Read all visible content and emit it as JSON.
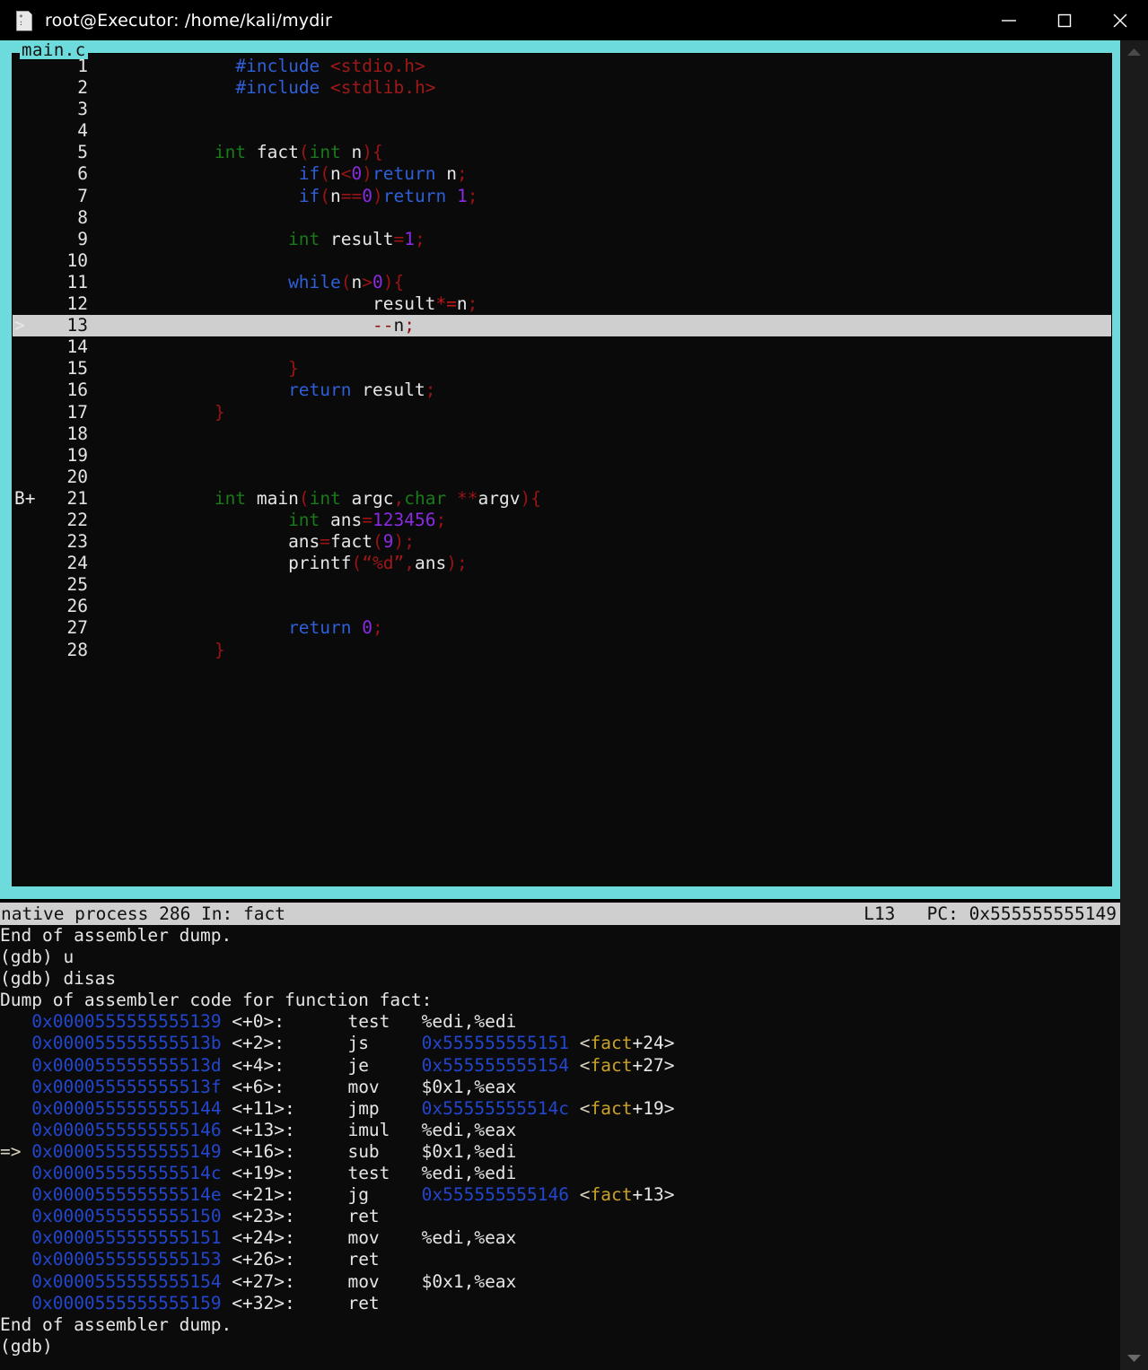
{
  "window": {
    "title": "root@Executor: /home/kali/mydir",
    "icon": "terminal-file-icon",
    "controls": {
      "minimize": "minimize-icon",
      "maximize": "maximize-icon",
      "close": "close-icon"
    }
  },
  "colors": {
    "frame": "#6ddbdb",
    "background": "#0b0b0b",
    "status_bg": "#cfcfcf",
    "address": "#2346cf",
    "symbol": "#c9a227",
    "keyword": "#2f5fd8",
    "type": "#1a7a1a",
    "punct": "#9b1414",
    "number": "#8a2be2",
    "string": "#a01818"
  },
  "source_pane": {
    "label": "main.c",
    "lines": [
      {
        "num": "1",
        "mark": "",
        "active": false,
        "tokens": [
          {
            "t": "              ",
            "c": "id"
          },
          {
            "t": "#include ",
            "c": "pre"
          },
          {
            "t": "<stdio.h>",
            "c": "str"
          }
        ]
      },
      {
        "num": "2",
        "mark": "",
        "active": false,
        "tokens": [
          {
            "t": "              ",
            "c": "id"
          },
          {
            "t": "#include ",
            "c": "pre"
          },
          {
            "t": "<stdlib.h>",
            "c": "str"
          }
        ]
      },
      {
        "num": "3",
        "mark": "",
        "active": false,
        "tokens": []
      },
      {
        "num": "4",
        "mark": "",
        "active": false,
        "tokens": []
      },
      {
        "num": "5",
        "mark": "",
        "active": false,
        "tokens": [
          {
            "t": "            ",
            "c": "id"
          },
          {
            "t": "int",
            "c": "type"
          },
          {
            "t": " fact",
            "c": "id"
          },
          {
            "t": "(",
            "c": "punc"
          },
          {
            "t": "int",
            "c": "type"
          },
          {
            "t": " n",
            "c": "id"
          },
          {
            "t": ")",
            "c": "punc"
          },
          {
            "t": "{",
            "c": "punc"
          }
        ]
      },
      {
        "num": "6",
        "mark": "",
        "active": false,
        "tokens": [
          {
            "t": "                    ",
            "c": "id"
          },
          {
            "t": "if",
            "c": "kw"
          },
          {
            "t": "(",
            "c": "punc"
          },
          {
            "t": "n",
            "c": "id"
          },
          {
            "t": "<",
            "c": "punc"
          },
          {
            "t": "0",
            "c": "num"
          },
          {
            "t": ")",
            "c": "punc"
          },
          {
            "t": "return",
            "c": "kw"
          },
          {
            "t": " n",
            "c": "id"
          },
          {
            "t": ";",
            "c": "punc"
          }
        ]
      },
      {
        "num": "7",
        "mark": "",
        "active": false,
        "tokens": [
          {
            "t": "                    ",
            "c": "id"
          },
          {
            "t": "if",
            "c": "kw"
          },
          {
            "t": "(",
            "c": "punc"
          },
          {
            "t": "n",
            "c": "id"
          },
          {
            "t": "==",
            "c": "punc"
          },
          {
            "t": "0",
            "c": "num"
          },
          {
            "t": ")",
            "c": "punc"
          },
          {
            "t": "return",
            "c": "kw"
          },
          {
            "t": " ",
            "c": "id"
          },
          {
            "t": "1",
            "c": "num"
          },
          {
            "t": ";",
            "c": "punc"
          }
        ]
      },
      {
        "num": "8",
        "mark": "",
        "active": false,
        "tokens": []
      },
      {
        "num": "9",
        "mark": "",
        "active": false,
        "tokens": [
          {
            "t": "                   ",
            "c": "id"
          },
          {
            "t": "int",
            "c": "type"
          },
          {
            "t": " result",
            "c": "id"
          },
          {
            "t": "=",
            "c": "punc"
          },
          {
            "t": "1",
            "c": "num"
          },
          {
            "t": ";",
            "c": "punc"
          }
        ]
      },
      {
        "num": "10",
        "mark": "",
        "active": false,
        "tokens": []
      },
      {
        "num": "11",
        "mark": "",
        "active": false,
        "tokens": [
          {
            "t": "                   ",
            "c": "id"
          },
          {
            "t": "while",
            "c": "kw"
          },
          {
            "t": "(",
            "c": "punc"
          },
          {
            "t": "n",
            "c": "id"
          },
          {
            "t": ">",
            "c": "punc"
          },
          {
            "t": "0",
            "c": "num"
          },
          {
            "t": ")",
            "c": "punc"
          },
          {
            "t": "{",
            "c": "punc"
          }
        ]
      },
      {
        "num": "12",
        "mark": "",
        "active": false,
        "tokens": [
          {
            "t": "                           ",
            "c": "id"
          },
          {
            "t": "result",
            "c": "id"
          },
          {
            "t": "*=",
            "c": "op"
          },
          {
            "t": "n",
            "c": "id"
          },
          {
            "t": ";",
            "c": "punc"
          }
        ]
      },
      {
        "num": "13",
        "mark": ">",
        "active": true,
        "tokens": [
          {
            "t": "                           ",
            "c": "id"
          },
          {
            "t": "--",
            "c": "punc"
          },
          {
            "t": "n",
            "c": "id"
          },
          {
            "t": ";",
            "c": "punc"
          }
        ]
      },
      {
        "num": "14",
        "mark": "",
        "active": false,
        "tokens": []
      },
      {
        "num": "15",
        "mark": "",
        "active": false,
        "tokens": [
          {
            "t": "                   ",
            "c": "id"
          },
          {
            "t": "}",
            "c": "punc"
          }
        ]
      },
      {
        "num": "16",
        "mark": "",
        "active": false,
        "tokens": [
          {
            "t": "                   ",
            "c": "id"
          },
          {
            "t": "return",
            "c": "kw"
          },
          {
            "t": " result",
            "c": "id"
          },
          {
            "t": ";",
            "c": "punc"
          }
        ]
      },
      {
        "num": "17",
        "mark": "",
        "active": false,
        "tokens": [
          {
            "t": "            ",
            "c": "id"
          },
          {
            "t": "}",
            "c": "punc"
          }
        ]
      },
      {
        "num": "18",
        "mark": "",
        "active": false,
        "tokens": []
      },
      {
        "num": "19",
        "mark": "",
        "active": false,
        "tokens": []
      },
      {
        "num": "20",
        "mark": "",
        "active": false,
        "tokens": []
      },
      {
        "num": "21",
        "mark": "B+",
        "active": false,
        "tokens": [
          {
            "t": "            ",
            "c": "id"
          },
          {
            "t": "int",
            "c": "type"
          },
          {
            "t": " main",
            "c": "id"
          },
          {
            "t": "(",
            "c": "punc"
          },
          {
            "t": "int",
            "c": "type"
          },
          {
            "t": " argc",
            "c": "id"
          },
          {
            "t": ",",
            "c": "punc"
          },
          {
            "t": "char",
            "c": "type"
          },
          {
            "t": " ",
            "c": "id"
          },
          {
            "t": "**",
            "c": "punc"
          },
          {
            "t": "argv",
            "c": "id"
          },
          {
            "t": ")",
            "c": "punc"
          },
          {
            "t": "{",
            "c": "punc"
          }
        ]
      },
      {
        "num": "22",
        "mark": "",
        "active": false,
        "tokens": [
          {
            "t": "                   ",
            "c": "id"
          },
          {
            "t": "int",
            "c": "type"
          },
          {
            "t": " ans",
            "c": "id"
          },
          {
            "t": "=",
            "c": "punc"
          },
          {
            "t": "123456",
            "c": "num"
          },
          {
            "t": ";",
            "c": "punc"
          }
        ]
      },
      {
        "num": "23",
        "mark": "",
        "active": false,
        "tokens": [
          {
            "t": "                   ",
            "c": "id"
          },
          {
            "t": "ans",
            "c": "id"
          },
          {
            "t": "=",
            "c": "punc"
          },
          {
            "t": "fact",
            "c": "id"
          },
          {
            "t": "(",
            "c": "punc"
          },
          {
            "t": "9",
            "c": "num"
          },
          {
            "t": ")",
            "c": "punc"
          },
          {
            "t": ";",
            "c": "punc"
          }
        ]
      },
      {
        "num": "24",
        "mark": "",
        "active": false,
        "tokens": [
          {
            "t": "                   ",
            "c": "id"
          },
          {
            "t": "printf",
            "c": "id"
          },
          {
            "t": "(",
            "c": "punc"
          },
          {
            "t": "“%d”",
            "c": "str"
          },
          {
            "t": ",",
            "c": "punc"
          },
          {
            "t": "ans",
            "c": "id"
          },
          {
            "t": ")",
            "c": "punc"
          },
          {
            "t": ";",
            "c": "punc"
          }
        ]
      },
      {
        "num": "25",
        "mark": "",
        "active": false,
        "tokens": []
      },
      {
        "num": "26",
        "mark": "",
        "active": false,
        "tokens": []
      },
      {
        "num": "27",
        "mark": "",
        "active": false,
        "tokens": [
          {
            "t": "                   ",
            "c": "id"
          },
          {
            "t": "return",
            "c": "kw"
          },
          {
            "t": " ",
            "c": "id"
          },
          {
            "t": "0",
            "c": "num"
          },
          {
            "t": ";",
            "c": "punc"
          }
        ]
      },
      {
        "num": "28",
        "mark": "",
        "active": false,
        "tokens": [
          {
            "t": "            ",
            "c": "id"
          },
          {
            "t": "}",
            "c": "punc"
          }
        ]
      }
    ]
  },
  "status_line": {
    "left": "native process 286 In: fact",
    "line_indicator": "L13",
    "pc_label": "PC: 0x555555555149"
  },
  "console": {
    "rows": [
      [
        {
          "t": "End of assembler dump.",
          "c": "plain"
        }
      ],
      [
        {
          "t": "(gdb) u",
          "c": "plain"
        }
      ],
      [
        {
          "t": "(gdb) disas",
          "c": "plain"
        }
      ],
      [
        {
          "t": "Dump of assembler code for function fact:",
          "c": "plain"
        }
      ],
      [
        {
          "t": "   ",
          "c": "plain"
        },
        {
          "t": "0x0000555555555139",
          "c": "addr"
        },
        {
          "t": " <+0>:\t",
          "c": "plain"
        },
        {
          "t": "   test   %edi,%edi",
          "c": "plain"
        }
      ],
      [
        {
          "t": "   ",
          "c": "plain"
        },
        {
          "t": "0x000055555555513b",
          "c": "addr"
        },
        {
          "t": " <+2>:\t",
          "c": "plain"
        },
        {
          "t": "   js     ",
          "c": "plain"
        },
        {
          "t": "0x555555555151",
          "c": "addr"
        },
        {
          "t": " <",
          "c": "arrow"
        },
        {
          "t": "fact",
          "c": "sym"
        },
        {
          "t": "+24>",
          "c": "plain"
        }
      ],
      [
        {
          "t": "   ",
          "c": "plain"
        },
        {
          "t": "0x000055555555513d",
          "c": "addr"
        },
        {
          "t": " <+4>:\t",
          "c": "plain"
        },
        {
          "t": "   je     ",
          "c": "plain"
        },
        {
          "t": "0x555555555154",
          "c": "addr"
        },
        {
          "t": " <",
          "c": "arrow"
        },
        {
          "t": "fact",
          "c": "sym"
        },
        {
          "t": "+27>",
          "c": "plain"
        }
      ],
      [
        {
          "t": "   ",
          "c": "plain"
        },
        {
          "t": "0x000055555555513f",
          "c": "addr"
        },
        {
          "t": " <+6>:\t",
          "c": "plain"
        },
        {
          "t": "   mov    $0x1,%eax",
          "c": "plain"
        }
      ],
      [
        {
          "t": "   ",
          "c": "plain"
        },
        {
          "t": "0x0000555555555144",
          "c": "addr"
        },
        {
          "t": " <+11>:\t",
          "c": "plain"
        },
        {
          "t": "  jmp    ",
          "c": "plain"
        },
        {
          "t": "0x55555555514c",
          "c": "addr"
        },
        {
          "t": " <",
          "c": "arrow"
        },
        {
          "t": "fact",
          "c": "sym"
        },
        {
          "t": "+19>",
          "c": "plain"
        }
      ],
      [
        {
          "t": "   ",
          "c": "plain"
        },
        {
          "t": "0x0000555555555146",
          "c": "addr"
        },
        {
          "t": " <+13>:\t",
          "c": "plain"
        },
        {
          "t": "  imul   %edi,%eax",
          "c": "plain"
        }
      ],
      [
        {
          "t": "=> ",
          "c": "arrow"
        },
        {
          "t": "0x0000555555555149",
          "c": "addr"
        },
        {
          "t": " <+16>:\t",
          "c": "plain"
        },
        {
          "t": "  sub    $0x1,%edi",
          "c": "plain"
        }
      ],
      [
        {
          "t": "   ",
          "c": "plain"
        },
        {
          "t": "0x000055555555514c",
          "c": "addr"
        },
        {
          "t": " <+19>:\t",
          "c": "plain"
        },
        {
          "t": "  test   %edi,%edi",
          "c": "plain"
        }
      ],
      [
        {
          "t": "   ",
          "c": "plain"
        },
        {
          "t": "0x000055555555514e",
          "c": "addr"
        },
        {
          "t": " <+21>:\t",
          "c": "plain"
        },
        {
          "t": "  jg     ",
          "c": "plain"
        },
        {
          "t": "0x555555555146",
          "c": "addr"
        },
        {
          "t": " <",
          "c": "arrow"
        },
        {
          "t": "fact",
          "c": "sym"
        },
        {
          "t": "+13>",
          "c": "plain"
        }
      ],
      [
        {
          "t": "   ",
          "c": "plain"
        },
        {
          "t": "0x0000555555555150",
          "c": "addr"
        },
        {
          "t": " <+23>:\t",
          "c": "plain"
        },
        {
          "t": "  ret",
          "c": "plain"
        }
      ],
      [
        {
          "t": "   ",
          "c": "plain"
        },
        {
          "t": "0x0000555555555151",
          "c": "addr"
        },
        {
          "t": " <+24>:\t",
          "c": "plain"
        },
        {
          "t": "  mov    %edi,%eax",
          "c": "plain"
        }
      ],
      [
        {
          "t": "   ",
          "c": "plain"
        },
        {
          "t": "0x0000555555555153",
          "c": "addr"
        },
        {
          "t": " <+26>:\t",
          "c": "plain"
        },
        {
          "t": "  ret",
          "c": "plain"
        }
      ],
      [
        {
          "t": "   ",
          "c": "plain"
        },
        {
          "t": "0x0000555555555154",
          "c": "addr"
        },
        {
          "t": " <+27>:\t",
          "c": "plain"
        },
        {
          "t": "  mov    $0x1,%eax",
          "c": "plain"
        }
      ],
      [
        {
          "t": "   ",
          "c": "plain"
        },
        {
          "t": "0x0000555555555159",
          "c": "addr"
        },
        {
          "t": " <+32>:\t",
          "c": "plain"
        },
        {
          "t": "  ret",
          "c": "plain"
        }
      ],
      [
        {
          "t": "End of assembler dump.",
          "c": "plain"
        }
      ],
      [
        {
          "t": "(gdb)",
          "c": "plain"
        }
      ]
    ]
  },
  "scrollbar": {
    "up_arrow": "scroll-up-icon",
    "down_arrow": "scroll-down-icon"
  }
}
